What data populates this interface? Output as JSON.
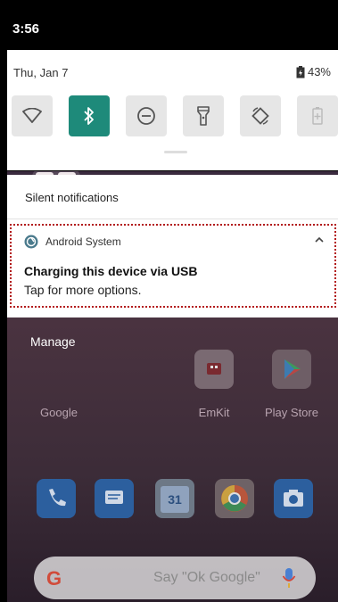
{
  "status_bar": {
    "time": "3:56"
  },
  "quick_settings": {
    "date": "Thu, Jan 7",
    "battery_percent": "43%",
    "tiles": [
      {
        "name": "wifi",
        "active": false
      },
      {
        "name": "bluetooth",
        "active": true
      },
      {
        "name": "do-not-disturb",
        "active": false
      },
      {
        "name": "flashlight",
        "active": false
      },
      {
        "name": "auto-rotate",
        "active": false
      },
      {
        "name": "battery-saver",
        "active": false
      }
    ]
  },
  "notifications": {
    "section_label": "Silent notifications",
    "items": [
      {
        "app_name": "Android System",
        "title": "Charging this device via USB",
        "text": "Tap for more options."
      }
    ],
    "manage_label": "Manage"
  },
  "home": {
    "apps": [
      {
        "label": "Google"
      },
      {
        "label": "EmKit"
      },
      {
        "label": "Play Store"
      }
    ],
    "calendar_day": "31",
    "search_hint": "Say \"Ok Google\"",
    "search_logo": "G"
  },
  "colors": {
    "bluetooth_tile": "#1e8a7a",
    "highlight_border": "#b3191a"
  }
}
